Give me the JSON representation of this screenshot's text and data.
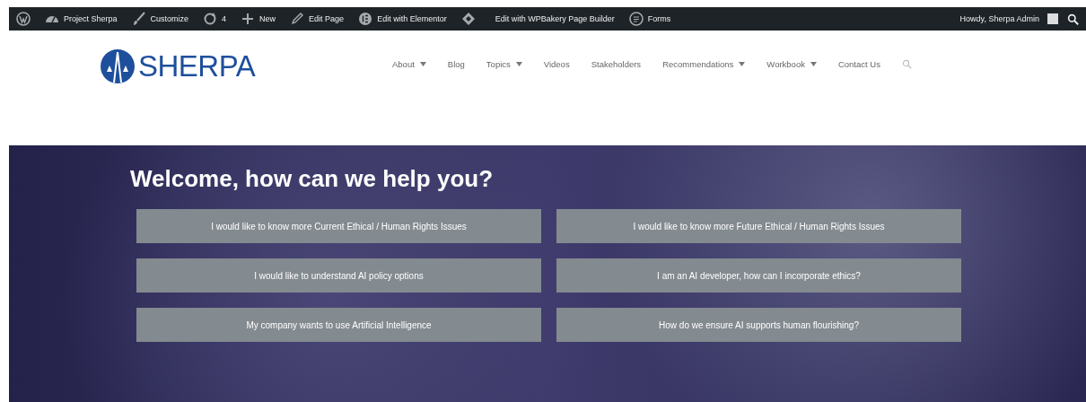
{
  "admin_bar": {
    "items": [
      {
        "kind": "logo"
      },
      {
        "kind": "site",
        "label": "Project Sherpa"
      },
      {
        "kind": "brush",
        "label": "Customize"
      },
      {
        "kind": "updates",
        "label": "4"
      },
      {
        "kind": "plus",
        "label": "New"
      },
      {
        "kind": "pencil",
        "label": "Edit Page"
      },
      {
        "kind": "elementor",
        "label": "Edit with Elementor"
      },
      {
        "kind": "diamond",
        "label": "Edit with WPBakery Page Builder"
      },
      {
        "kind": "forms",
        "label": "Forms"
      }
    ],
    "greeting": "Howdy, Sherpa Admin"
  },
  "header": {
    "logo_text": "SHERPA",
    "nav": [
      {
        "label": "About",
        "has_dropdown": true
      },
      {
        "label": "Blog",
        "has_dropdown": false
      },
      {
        "label": "Topics",
        "has_dropdown": true
      },
      {
        "label": "Videos",
        "has_dropdown": false
      },
      {
        "label": "Stakeholders",
        "has_dropdown": false
      },
      {
        "label": "Recommendations",
        "has_dropdown": true
      },
      {
        "label": "Workbook",
        "has_dropdown": true
      },
      {
        "label": "Contact Us",
        "has_dropdown": false
      }
    ]
  },
  "hero": {
    "heading": "Welcome, how can we help you?",
    "buttons": [
      "I would like to know more Current Ethical / Human Rights Issues",
      "I would like to know more Future Ethical / Human Rights Issues",
      "I would like to understand AI policy options",
      "I am an AI developer, how can I incorporate ethics?",
      "My company wants to use Artificial Intelligence",
      "How do we ensure AI supports human flourishing?"
    ]
  }
}
